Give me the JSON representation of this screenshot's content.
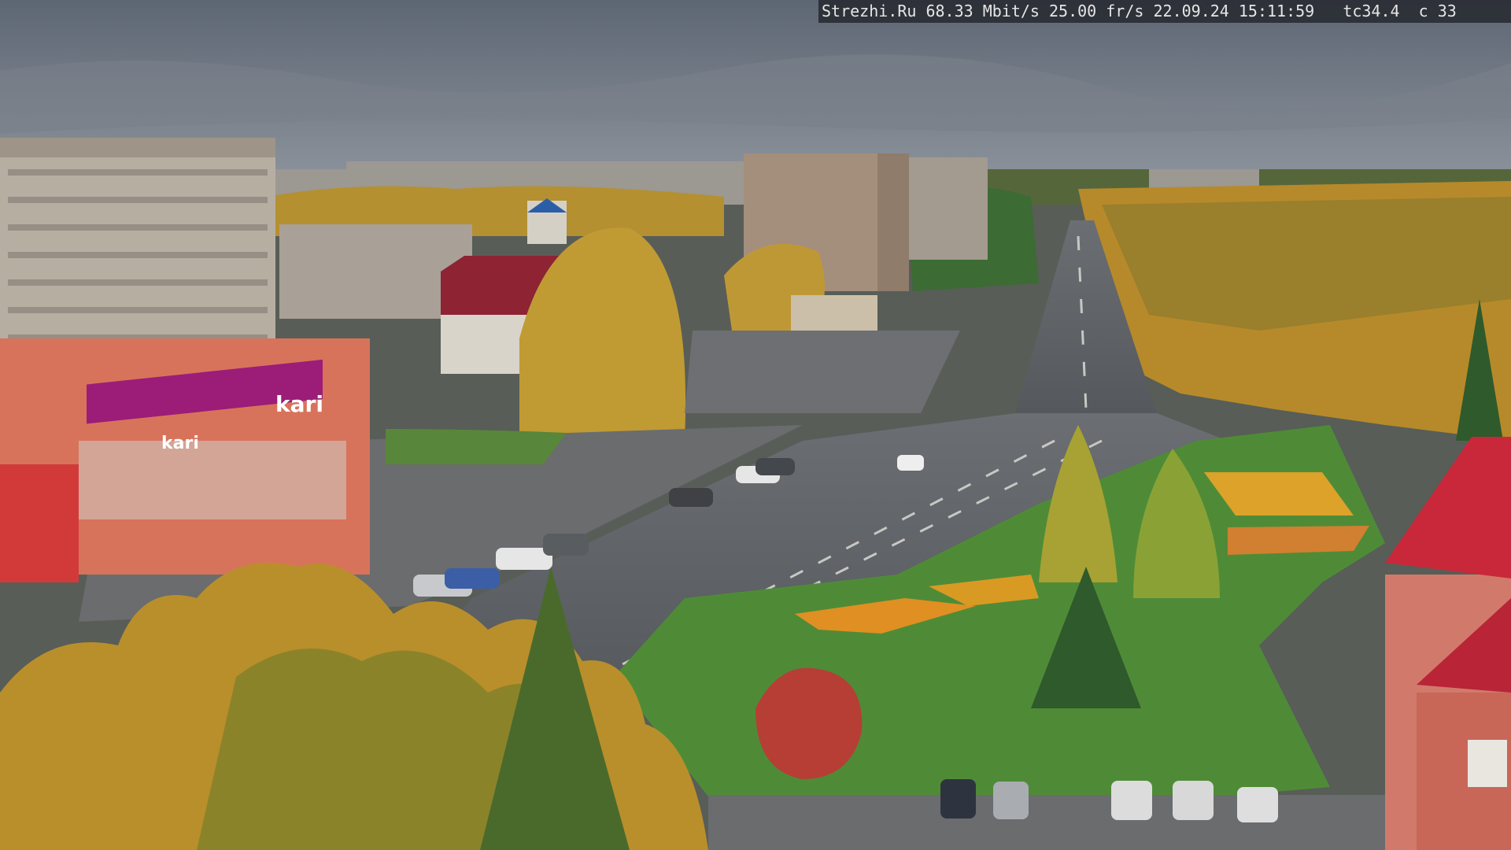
{
  "overlay": {
    "source": "Strezhi.Ru",
    "bitrate": "68.33 Mbit/s",
    "fps": "25.00 fr/s",
    "date": "22.09.24",
    "time": "15:11:59",
    "camera": "tc34.4",
    "channel": "c 33"
  },
  "store_sign": {
    "brand": "kari",
    "banner_small": "kari"
  },
  "colors": {
    "sky": "#6f7782",
    "road": "#5c5f63",
    "grass": "#4e8a36",
    "autumn_tree": "#c99a2a",
    "store_facade": "#d9735a",
    "store_banner": "#9b1d78",
    "tower_roof": "#c8283a",
    "flowerbed": "#e0a020"
  }
}
